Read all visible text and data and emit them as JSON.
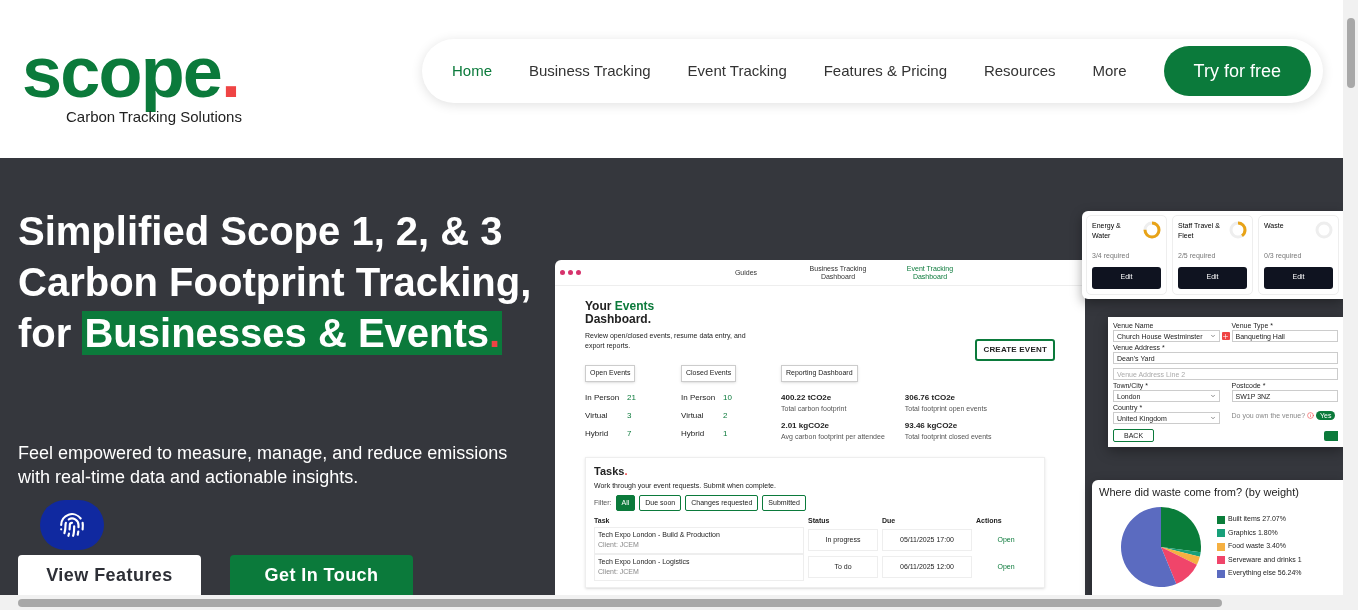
{
  "logo": {
    "word": "scope",
    "dot": ".",
    "tagline": "Carbon Tracking Solutions"
  },
  "nav": {
    "items": [
      {
        "label": "Home",
        "selected": true
      },
      {
        "label": "Business Tracking",
        "selected": false
      },
      {
        "label": "Event Tracking",
        "selected": false
      },
      {
        "label": "Features & Pricing",
        "selected": false
      },
      {
        "label": "Resources",
        "selected": false
      },
      {
        "label": "More",
        "selected": false
      }
    ],
    "cta": "Try for free"
  },
  "hero": {
    "title_lines": [
      "Simplified Scope 1, 2, & 3",
      "Carbon Footprint Tracking,"
    ],
    "title_prefix": "for",
    "title_highlight": "Businesses & Events",
    "title_dot": ".",
    "subtitle": "Feel empowered to measure, manage, and reduce emissions with real-time data and actionable insights.",
    "buttons": [
      {
        "label": "View Features",
        "kind": "secondary"
      },
      {
        "label": "Get In Touch",
        "kind": "primary"
      }
    ]
  },
  "mockup": {
    "dashboard": {
      "nav": [
        {
          "label": "Guides",
          "selected": false
        },
        {
          "label": "Business Tracking Dashboard",
          "selected": false
        },
        {
          "label": "Event Tracking Dashboard",
          "selected": true
        }
      ],
      "title_before": "Your",
      "title_accent": "Events",
      "title_after": "Dashboard.",
      "description": "Review open/closed events, resume data entry, and export reports.",
      "create_button": "CREATE EVENT",
      "groups": [
        {
          "button": "Open Events",
          "stats": [
            {
              "label": "In Person",
              "value": "21"
            },
            {
              "label": "Virtual",
              "value": "3"
            },
            {
              "label": "Hybrid",
              "value": "7"
            }
          ]
        },
        {
          "button": "Closed Events",
          "stats": [
            {
              "label": "In Person",
              "value": "10"
            },
            {
              "label": "Virtual",
              "value": "2"
            },
            {
              "label": "Hybrid",
              "value": "1"
            }
          ]
        }
      ],
      "reporting_button": "Reporting Dashboard",
      "metrics": [
        {
          "value": "400.22 tCO2e",
          "label": "Total carbon footprint"
        },
        {
          "value": "306.76 tCO2e",
          "label": "Total footprint open events"
        },
        {
          "value": "2.01 kgCO2e",
          "label": "Avg carbon footprint per attendee"
        },
        {
          "value": "93.46 kgCO2e",
          "label": "Total footprint closed events"
        }
      ]
    },
    "tasks": {
      "title": "Tasks",
      "title_dot": ".",
      "description": "Work through your event requests. Submit when complete.",
      "filter_label": "Filter:",
      "filters": [
        {
          "label": "All",
          "selected": true
        },
        {
          "label": "Due soon",
          "selected": false
        },
        {
          "label": "Changes requested",
          "selected": false
        },
        {
          "label": "Submitted",
          "selected": false
        }
      ],
      "columns": [
        "Task",
        "Status",
        "Due",
        "Actions"
      ],
      "rows": [
        {
          "task": "Tech Expo London - Build & Production",
          "client": "Client: JCEM",
          "status": "In progress",
          "due": "05/11/2025 17:00",
          "action": "Open"
        },
        {
          "task": "Tech Expo London - Logistics",
          "client": "Client: JCEM",
          "status": "To do",
          "due": "06/11/2025 12:00",
          "action": "Open"
        }
      ]
    },
    "categories": [
      {
        "name": "Energy & Water",
        "required": "3/4 required",
        "level": 0.75,
        "button": "Edit"
      },
      {
        "name": "Staff Travel & Fleet",
        "required": "2/5 required",
        "level": 0.4,
        "button": "Edit"
      },
      {
        "name": "Waste",
        "required": "0/3 required",
        "level": 0,
        "button": "Edit"
      }
    ],
    "venue_form": {
      "fields": [
        {
          "label": "Venue Name",
          "value": "Church House Westminster",
          "kind": "select"
        },
        {
          "label": "Venue Type *",
          "value": "Banqueting Hall",
          "kind": "text"
        },
        {
          "label": "Venue Address *",
          "value": "Dean's Yard",
          "kind": "text",
          "wide": true
        },
        {
          "placeholder": "Venue Address Line 2",
          "kind": "text",
          "wide": true
        },
        {
          "label": "Town/City *",
          "value": "London",
          "kind": "select"
        },
        {
          "label": "Postcode *",
          "value": "SW1P 3NZ",
          "kind": "text"
        },
        {
          "label": "Country *",
          "value": "United Kingdom",
          "kind": "select"
        }
      ],
      "own_question": "Do you own the venue?",
      "own_toggle": "Yes",
      "back_button": "BACK"
    },
    "waste_chart": {
      "legend_values": [
        "27.07%",
        "1.80%",
        "3.40%",
        "1",
        "56.24%"
      ],
      "chart_data": {
        "type": "pie",
        "title": "Where did waste come from? (by weight)",
        "categories": [
          "Built items",
          "Graphics",
          "Food waste",
          "Serveware and drinks",
          "Everything else"
        ],
        "values": [
          27.07,
          1.8,
          3.4,
          11.49,
          56.24
        ],
        "colors": [
          "#0a7d3a",
          "#18a07a",
          "#f5b041",
          "#f0456a",
          "#5b6bc0"
        ]
      }
    }
  }
}
